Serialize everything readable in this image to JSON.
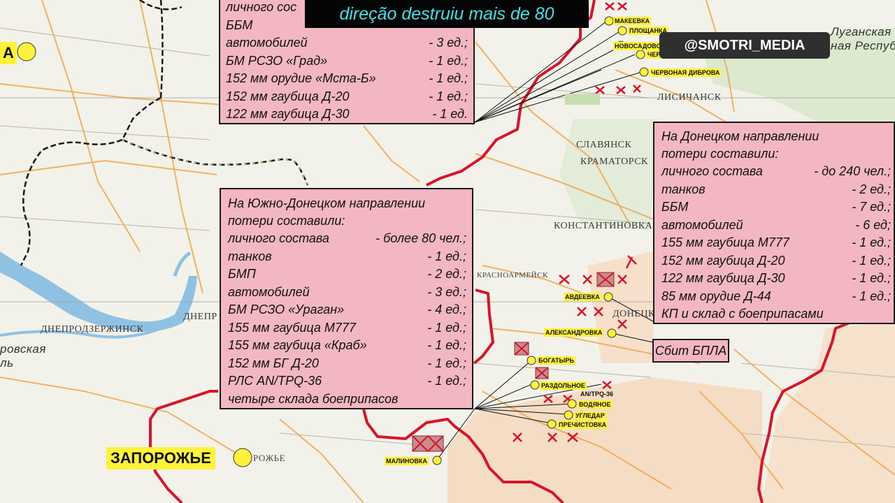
{
  "caption": "direção destruiu mais de 80",
  "watermark": "@SMOTRI_MEDIA",
  "uav_label": "Сбит БПЛА",
  "cities": {
    "zaporozhye": "ЗАПОРОЖЬЕ",
    "top_left_fragment": "А"
  },
  "map_labels": {
    "lysychansk": "ЛИСИЧАНСК",
    "slavyansk": "СЛАВЯНСК",
    "kramatorsk": "КРАМАТОРСК",
    "konstantinovka": "КОНСТАНТИНОВКА",
    "donetsk": "ДОНЕЦК",
    "dneprodzerzhinsk": "ДНЕПРОДЗЕРЖИНСК",
    "dnepr": "ДНЕПР",
    "krasnoarmeysk": "КРАСНОАРМЕЙСК",
    "lugansk_region_1": "Луганская",
    "lugansk_region_2": "ная Республ",
    "left_region_1": "ровская",
    "left_region_2": "ль",
    "zap_suffix": "РОЖЬЕ"
  },
  "settlements": [
    {
      "name": "МАКЕЕВКА"
    },
    {
      "name": "ПЛОЩАНКА"
    },
    {
      "name": "НОВОСАДОВОЕ"
    },
    {
      "name": "ЧЕР"
    },
    {
      "name": "ЧЕРВОНАЯ ДИБРОВА"
    },
    {
      "name": "АВДЕЕВКА"
    },
    {
      "name": "АЛЕКСАНДРОВКА"
    },
    {
      "name": "БОГАТЫРЬ"
    },
    {
      "name": "РАЗДОЛЬНОЕ"
    },
    {
      "name": "ВОДЯНОЕ"
    },
    {
      "name": "УГЛЕДАР"
    },
    {
      "name": "ПРЕЧИСТОВКА"
    },
    {
      "name": "МАЛИНОВКА"
    },
    {
      "name": "AN/TPQ-36"
    }
  ],
  "box_top": {
    "header": "личного сос",
    "rows": [
      {
        "label": "ББМ",
        "value": ""
      },
      {
        "label": "автомобилей",
        "value": "- 3 ед.;"
      },
      {
        "label": "БМ РСЗО «Град»",
        "value": "- 1 ед.;"
      },
      {
        "label": "152 мм орудие «Мста-Б»",
        "value": "- 1 ед.;"
      },
      {
        "label": "152 мм гаубица Д-20",
        "value": "- 1 ед.;"
      },
      {
        "label": "122 мм гаубица Д-30",
        "value": "- 1 ед."
      }
    ]
  },
  "box_south": {
    "header_1": "На Южно-Донецком направлении",
    "header_2": "потери составили:",
    "rows": [
      {
        "label": "личного состава",
        "value": "- более 80 чел.;"
      },
      {
        "label": "танков",
        "value": "- 1 ед.;"
      },
      {
        "label": "БМП",
        "value": "- 2 ед.;"
      },
      {
        "label": "автомобилей",
        "value": "- 3 ед.;"
      },
      {
        "label": "БМ РСЗО «Ураган»",
        "value": "- 4 ед.;"
      },
      {
        "label": "155 мм гаубица М777",
        "value": "- 1 ед.;"
      },
      {
        "label": "155 мм гаубица «Краб»",
        "value": "- 1 ед.;"
      },
      {
        "label": "152 мм БГ Д-20",
        "value": "- 1 ед.;"
      },
      {
        "label": "РЛС AN/TPQ-36",
        "value": "- 1 ед.;"
      }
    ],
    "footer": "четыре склада боеприпасов"
  },
  "box_donetsk": {
    "header_1": "На Донецком направлении",
    "header_2": "потери составили:",
    "rows": [
      {
        "label": "личного состава",
        "value": "- до 240 чел.;"
      },
      {
        "label": "танков",
        "value": "- 2 ед.;"
      },
      {
        "label": "ББМ",
        "value": "- 7 ед.;"
      },
      {
        "label": "автомобилей",
        "value": "- 6 ед;"
      },
      {
        "label": "155 мм гаубица М777",
        "value": "- 1 ед.;"
      },
      {
        "label": "152 мм гаубица Д-20",
        "value": "- 1 ед.;"
      },
      {
        "label": "122 мм гаубица Д-30",
        "value": "- 1 ед.;"
      },
      {
        "label": "85 мм  орудие Д-44",
        "value": "- 1 ед.;"
      }
    ],
    "footer": "КП и склад с боеприпасами"
  },
  "colors": {
    "front_line": "#d8142b",
    "box_fill": "#f2b7c0",
    "highlight": "#fff23a",
    "caption_text": "#3fe0e8",
    "water": "#8fc1e3",
    "occupied_area": "#f5dcc4"
  }
}
